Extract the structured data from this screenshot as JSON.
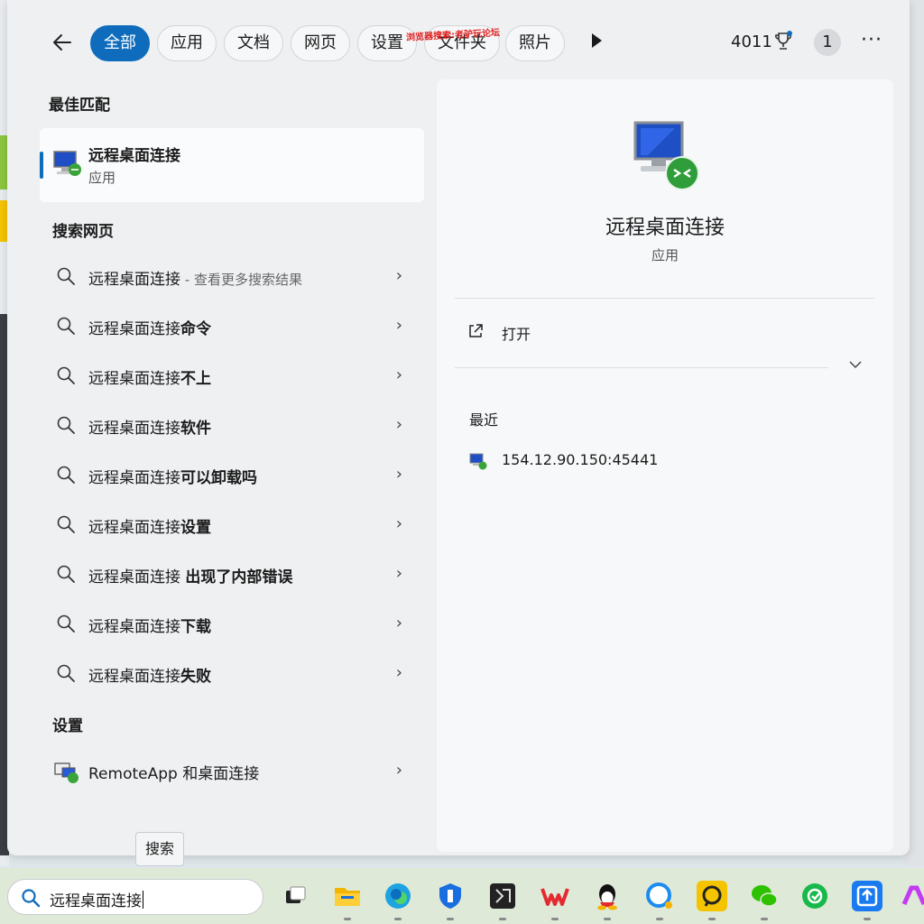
{
  "filters": {
    "tabs": [
      {
        "label": "全部",
        "active": true
      },
      {
        "label": "应用"
      },
      {
        "label": "文档"
      },
      {
        "label": "网页"
      },
      {
        "label": "设置"
      },
      {
        "label": "文件夹"
      },
      {
        "label": "照片"
      }
    ],
    "points": "4011",
    "notification_count": "1",
    "watermark": "浏览器搜索:老驴玩论坛"
  },
  "best_match": {
    "section_title": "最佳匹配",
    "name": "远程桌面连接",
    "type": "应用"
  },
  "web_search": {
    "section_title": "搜索网页",
    "items": [
      {
        "prefix": "远程桌面连接",
        "bold": "",
        "hint": " - 查看更多搜索结果"
      },
      {
        "prefix": "远程桌面连接",
        "bold": "命令",
        "hint": ""
      },
      {
        "prefix": "远程桌面连接",
        "bold": "不上",
        "hint": ""
      },
      {
        "prefix": "远程桌面连接",
        "bold": "软件",
        "hint": ""
      },
      {
        "prefix": "远程桌面连接",
        "bold": "可以卸载吗",
        "hint": ""
      },
      {
        "prefix": "远程桌面连接",
        "bold": "设置",
        "hint": ""
      },
      {
        "prefix": "远程桌面连接 ",
        "bold": "出现了内部错误",
        "hint": ""
      },
      {
        "prefix": "远程桌面连接",
        "bold": "下载",
        "hint": ""
      },
      {
        "prefix": "远程桌面连接",
        "bold": "失败",
        "hint": ""
      }
    ]
  },
  "settings": {
    "section_title": "设置",
    "items": [
      {
        "label": "RemoteApp 和桌面连接"
      }
    ]
  },
  "detail": {
    "title": "远程桌面连接",
    "subtitle": "应用",
    "open_label": "打开",
    "recent_title": "最近",
    "recent_items": [
      {
        "label": "154.12.90.150:45441"
      }
    ]
  },
  "tooltip": "搜索",
  "taskbar": {
    "search_value": "远程桌面连接",
    "apps": [
      "task-view",
      "file-explorer",
      "edge",
      "security",
      "terminal",
      "wps",
      "qq",
      "chat",
      "todesk",
      "wechat",
      "green-app",
      "upload-app",
      "copilot"
    ]
  },
  "colors": {
    "accent": "#0f6cbd"
  }
}
